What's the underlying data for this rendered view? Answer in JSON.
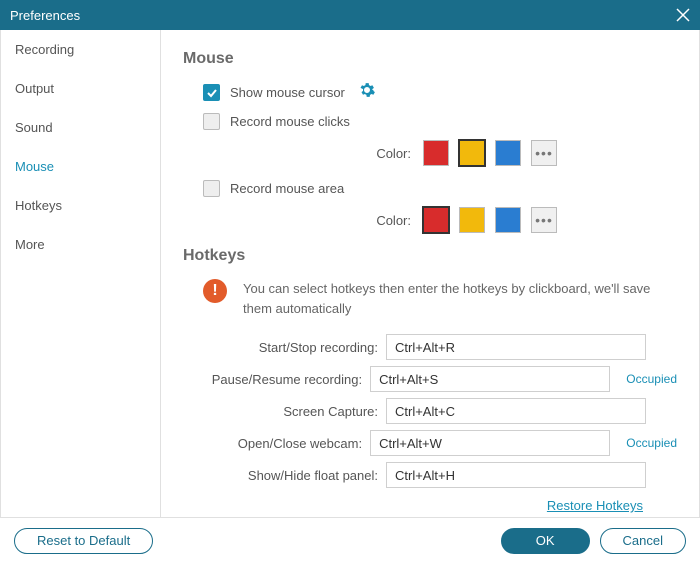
{
  "title": "Preferences",
  "sidebar": {
    "items": [
      {
        "label": "Recording"
      },
      {
        "label": "Output"
      },
      {
        "label": "Sound"
      },
      {
        "label": "Mouse",
        "active": true
      },
      {
        "label": "Hotkeys"
      },
      {
        "label": "More"
      }
    ]
  },
  "mouse": {
    "title": "Mouse",
    "show_cursor_label": "Show mouse cursor",
    "show_cursor_checked": true,
    "record_clicks_label": "Record mouse clicks",
    "record_clicks_checked": false,
    "record_area_label": "Record mouse area",
    "record_area_checked": false,
    "color_label": "Color:",
    "clicks_colors": {
      "items": [
        "#d82c2c",
        "#f2b90c",
        "#2a7dd1"
      ],
      "selected": 1,
      "more_label": "•••"
    },
    "area_colors": {
      "items": [
        "#d82c2c",
        "#f2b90c",
        "#2a7dd1"
      ],
      "selected": 0,
      "more_label": "•••"
    }
  },
  "hotkeys": {
    "title": "Hotkeys",
    "info": "You can select hotkeys then enter the hotkeys by clickboard, we'll save them automatically",
    "rows": [
      {
        "label": "Start/Stop recording:",
        "value": "Ctrl+Alt+R",
        "status": ""
      },
      {
        "label": "Pause/Resume recording:",
        "value": "Ctrl+Alt+S",
        "status": "Occupied"
      },
      {
        "label": "Screen Capture:",
        "value": "Ctrl+Alt+C",
        "status": ""
      },
      {
        "label": "Open/Close webcam:",
        "value": "Ctrl+Alt+W",
        "status": "Occupied"
      },
      {
        "label": "Show/Hide float panel:",
        "value": "Ctrl+Alt+H",
        "status": ""
      }
    ],
    "restore_label": "Restore Hotkeys"
  },
  "footer": {
    "reset": "Reset to Default",
    "ok": "OK",
    "cancel": "Cancel"
  }
}
